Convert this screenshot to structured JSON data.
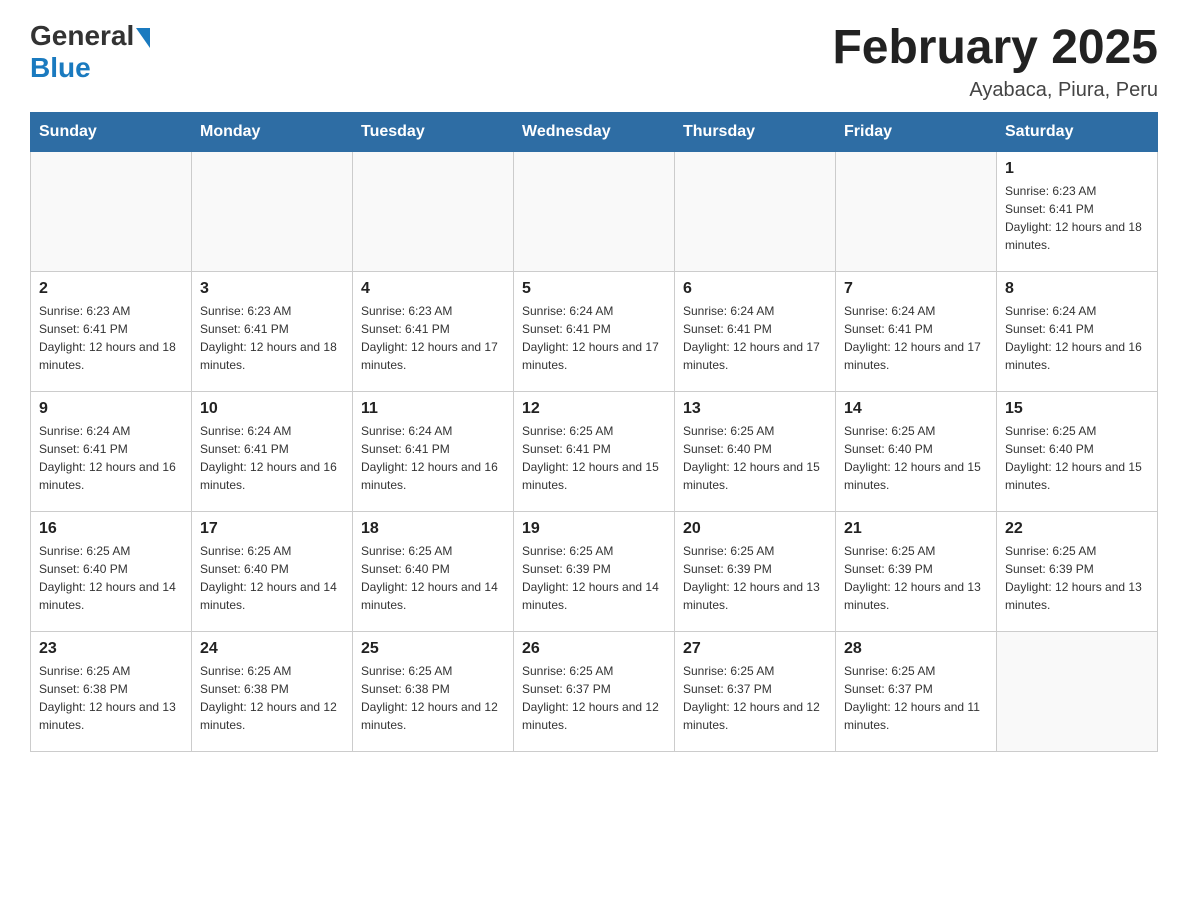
{
  "logo": {
    "general": "General",
    "blue": "Blue"
  },
  "title": {
    "month_year": "February 2025",
    "location": "Ayabaca, Piura, Peru"
  },
  "weekdays": [
    "Sunday",
    "Monday",
    "Tuesday",
    "Wednesday",
    "Thursday",
    "Friday",
    "Saturday"
  ],
  "weeks": [
    [
      {
        "day": "",
        "info": ""
      },
      {
        "day": "",
        "info": ""
      },
      {
        "day": "",
        "info": ""
      },
      {
        "day": "",
        "info": ""
      },
      {
        "day": "",
        "info": ""
      },
      {
        "day": "",
        "info": ""
      },
      {
        "day": "1",
        "info": "Sunrise: 6:23 AM\nSunset: 6:41 PM\nDaylight: 12 hours and 18 minutes."
      }
    ],
    [
      {
        "day": "2",
        "info": "Sunrise: 6:23 AM\nSunset: 6:41 PM\nDaylight: 12 hours and 18 minutes."
      },
      {
        "day": "3",
        "info": "Sunrise: 6:23 AM\nSunset: 6:41 PM\nDaylight: 12 hours and 18 minutes."
      },
      {
        "day": "4",
        "info": "Sunrise: 6:23 AM\nSunset: 6:41 PM\nDaylight: 12 hours and 17 minutes."
      },
      {
        "day": "5",
        "info": "Sunrise: 6:24 AM\nSunset: 6:41 PM\nDaylight: 12 hours and 17 minutes."
      },
      {
        "day": "6",
        "info": "Sunrise: 6:24 AM\nSunset: 6:41 PM\nDaylight: 12 hours and 17 minutes."
      },
      {
        "day": "7",
        "info": "Sunrise: 6:24 AM\nSunset: 6:41 PM\nDaylight: 12 hours and 17 minutes."
      },
      {
        "day": "8",
        "info": "Sunrise: 6:24 AM\nSunset: 6:41 PM\nDaylight: 12 hours and 16 minutes."
      }
    ],
    [
      {
        "day": "9",
        "info": "Sunrise: 6:24 AM\nSunset: 6:41 PM\nDaylight: 12 hours and 16 minutes."
      },
      {
        "day": "10",
        "info": "Sunrise: 6:24 AM\nSunset: 6:41 PM\nDaylight: 12 hours and 16 minutes."
      },
      {
        "day": "11",
        "info": "Sunrise: 6:24 AM\nSunset: 6:41 PM\nDaylight: 12 hours and 16 minutes."
      },
      {
        "day": "12",
        "info": "Sunrise: 6:25 AM\nSunset: 6:41 PM\nDaylight: 12 hours and 15 minutes."
      },
      {
        "day": "13",
        "info": "Sunrise: 6:25 AM\nSunset: 6:40 PM\nDaylight: 12 hours and 15 minutes."
      },
      {
        "day": "14",
        "info": "Sunrise: 6:25 AM\nSunset: 6:40 PM\nDaylight: 12 hours and 15 minutes."
      },
      {
        "day": "15",
        "info": "Sunrise: 6:25 AM\nSunset: 6:40 PM\nDaylight: 12 hours and 15 minutes."
      }
    ],
    [
      {
        "day": "16",
        "info": "Sunrise: 6:25 AM\nSunset: 6:40 PM\nDaylight: 12 hours and 14 minutes."
      },
      {
        "day": "17",
        "info": "Sunrise: 6:25 AM\nSunset: 6:40 PM\nDaylight: 12 hours and 14 minutes."
      },
      {
        "day": "18",
        "info": "Sunrise: 6:25 AM\nSunset: 6:40 PM\nDaylight: 12 hours and 14 minutes."
      },
      {
        "day": "19",
        "info": "Sunrise: 6:25 AM\nSunset: 6:39 PM\nDaylight: 12 hours and 14 minutes."
      },
      {
        "day": "20",
        "info": "Sunrise: 6:25 AM\nSunset: 6:39 PM\nDaylight: 12 hours and 13 minutes."
      },
      {
        "day": "21",
        "info": "Sunrise: 6:25 AM\nSunset: 6:39 PM\nDaylight: 12 hours and 13 minutes."
      },
      {
        "day": "22",
        "info": "Sunrise: 6:25 AM\nSunset: 6:39 PM\nDaylight: 12 hours and 13 minutes."
      }
    ],
    [
      {
        "day": "23",
        "info": "Sunrise: 6:25 AM\nSunset: 6:38 PM\nDaylight: 12 hours and 13 minutes."
      },
      {
        "day": "24",
        "info": "Sunrise: 6:25 AM\nSunset: 6:38 PM\nDaylight: 12 hours and 12 minutes."
      },
      {
        "day": "25",
        "info": "Sunrise: 6:25 AM\nSunset: 6:38 PM\nDaylight: 12 hours and 12 minutes."
      },
      {
        "day": "26",
        "info": "Sunrise: 6:25 AM\nSunset: 6:37 PM\nDaylight: 12 hours and 12 minutes."
      },
      {
        "day": "27",
        "info": "Sunrise: 6:25 AM\nSunset: 6:37 PM\nDaylight: 12 hours and 12 minutes."
      },
      {
        "day": "28",
        "info": "Sunrise: 6:25 AM\nSunset: 6:37 PM\nDaylight: 12 hours and 11 minutes."
      },
      {
        "day": "",
        "info": ""
      }
    ]
  ]
}
